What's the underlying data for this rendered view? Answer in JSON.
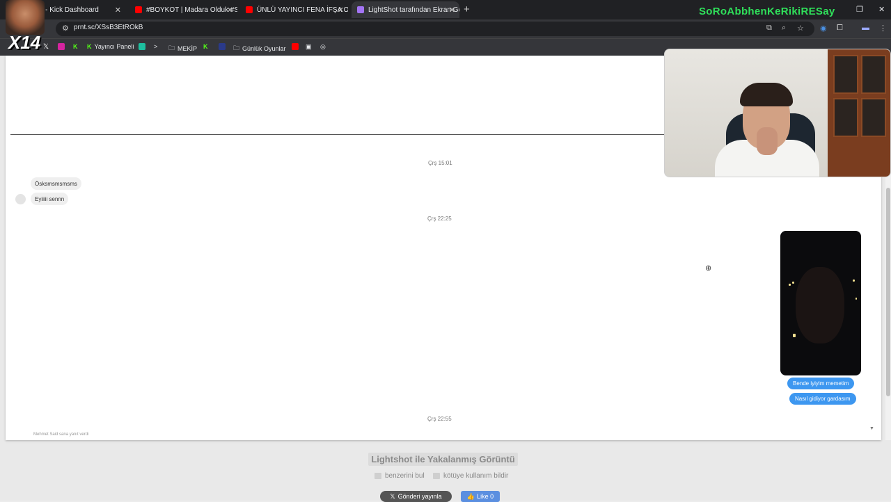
{
  "browser": {
    "tabs": [
      {
        "label": "m - Kick Dashboard",
        "icon": "kick-icon",
        "color": "#53fc18"
      },
      {
        "label": "#BOYKOT | Madara Olduk #SEN",
        "icon": "youtube-icon",
        "color": "#ff0000"
      },
      {
        "label": "ÜNLÜ YAYINCI FENA İFŞA OLDU",
        "icon": "youtube-icon",
        "color": "#ff0000"
      },
      {
        "label": "LightShot tarafından Ekran Gör",
        "icon": "lightshot-icon",
        "color": "#a374f4"
      }
    ],
    "new_tab": "+",
    "url": "prnt.sc/XSsB3EtROkB",
    "bookmarks": [
      {
        "label": "",
        "icon": "x-icon"
      },
      {
        "label": "",
        "icon": "instagram-icon"
      },
      {
        "label": "",
        "icon": "kick-icon"
      },
      {
        "label": "Yayıncı Paneli",
        "icon": "kick-icon"
      },
      {
        "label": "",
        "icon": "app-icon"
      },
      {
        "label": ">",
        "icon": "terminal-icon"
      },
      {
        "label": "MEKİP",
        "icon": "folder-icon"
      },
      {
        "label": "",
        "icon": "kick-icon"
      },
      {
        "label": "",
        "icon": "blank-icon"
      },
      {
        "label": "Günlük Oyunlar",
        "icon": "folder-icon"
      },
      {
        "label": "",
        "icon": "youtube-icon"
      },
      {
        "label": "",
        "icon": "image-icon"
      },
      {
        "label": "",
        "icon": "settings-icon"
      }
    ]
  },
  "stream_overlay": {
    "name": "SoRoAbbhenKeRikiRESay",
    "badge": "X14"
  },
  "chat": {
    "timestamps": [
      "Çrş 15:01",
      "Çrş 22:25",
      "Çrş 22:55"
    ],
    "incoming": [
      "Ösksmsmsmsms",
      "Eyiiiii sennn"
    ],
    "outgoing": [
      "Bende iyiyim memetim",
      "Nasıl gidiyor gardasım"
    ],
    "cut_text": "Mehmet Said sana yanıt verdi"
  },
  "footer": {
    "title": "Lightshot ile Yakalanmış Görüntü",
    "find_similar": "benzerini bul",
    "report_abuse": "kötüye kullanım bildir",
    "share_x": "Gönderi yayınla",
    "like": "Like 0"
  }
}
